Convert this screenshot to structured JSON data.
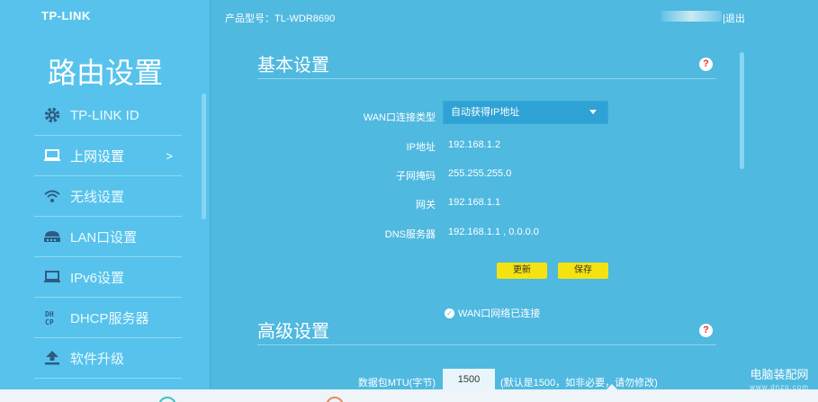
{
  "sidebar": {
    "logo": "TP-LINK",
    "title": "路由设置",
    "items": [
      {
        "label": "TP-LINK ID",
        "icon": "gear-icon"
      },
      {
        "label": "上网设置",
        "icon": "laptop-icon",
        "arrow": ">"
      },
      {
        "label": "无线设置",
        "icon": "wifi-icon"
      },
      {
        "label": "LAN口设置",
        "icon": "lan-icon"
      },
      {
        "label": "IPv6设置",
        "icon": "laptop-icon"
      },
      {
        "label": "DHCP服务器",
        "icon": "dhcp-icon",
        "icon_text": "DH\nCP"
      },
      {
        "label": "软件升级",
        "icon": "upload-icon"
      }
    ]
  },
  "topbar": {
    "model": "产品型号：TL-WDR8690",
    "logout": "|退出"
  },
  "basic": {
    "title": "基本设置",
    "help": "?",
    "wan_label": "WAN口连接类型",
    "wan_value": "自动获得IP地址",
    "ip_label": "IP地址",
    "ip_value": "192.168.1.2",
    "mask_label": "子网掩码",
    "mask_value": "255.255.255.0",
    "gw_label": "网关",
    "gw_value": "192.168.1.1",
    "dns_label": "DNS服务器",
    "dns_value": "192.168.1.1 , 0.0.0.0",
    "refresh_btn": "更新",
    "save_btn": "保存",
    "status": "WAN口网络已连接"
  },
  "advanced": {
    "title": "高级设置",
    "help": "?",
    "mtu_label": "数据包MTU(字节)",
    "mtu_value": "1500",
    "mtu_hint": "(默认是1500，如非必要，请勿修改)"
  },
  "watermark": {
    "title": "电脑装配网",
    "url": "www.dnzp.com"
  }
}
